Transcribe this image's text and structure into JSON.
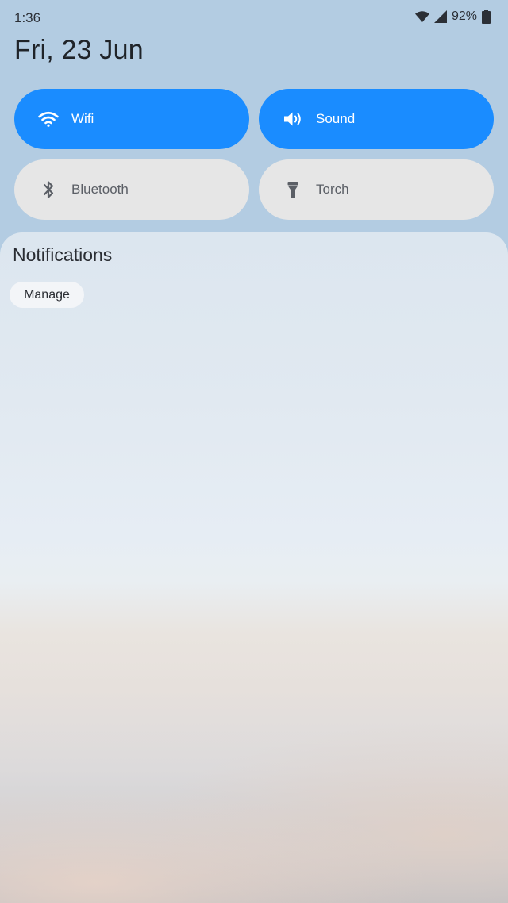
{
  "status_bar": {
    "time": "1:36",
    "battery_percent": "92%",
    "icons": [
      "wifi-icon",
      "signal-icon",
      "battery-icon"
    ]
  },
  "date": "Fri, 23 Jun",
  "quick_tiles": [
    {
      "label": "Wifi",
      "icon": "wifi-icon",
      "state": "on"
    },
    {
      "label": "Sound",
      "icon": "speaker-icon",
      "state": "on"
    },
    {
      "label": "Bluetooth",
      "icon": "bluetooth-icon",
      "state": "off"
    },
    {
      "label": "Torch",
      "icon": "flashlight-icon",
      "state": "off"
    }
  ],
  "notifications": {
    "title": "Notifications",
    "manage_label": "Manage"
  },
  "colors": {
    "tile_on": "#1a8cff",
    "tile_off": "#e6e6e6",
    "background": "#b3cce2"
  }
}
